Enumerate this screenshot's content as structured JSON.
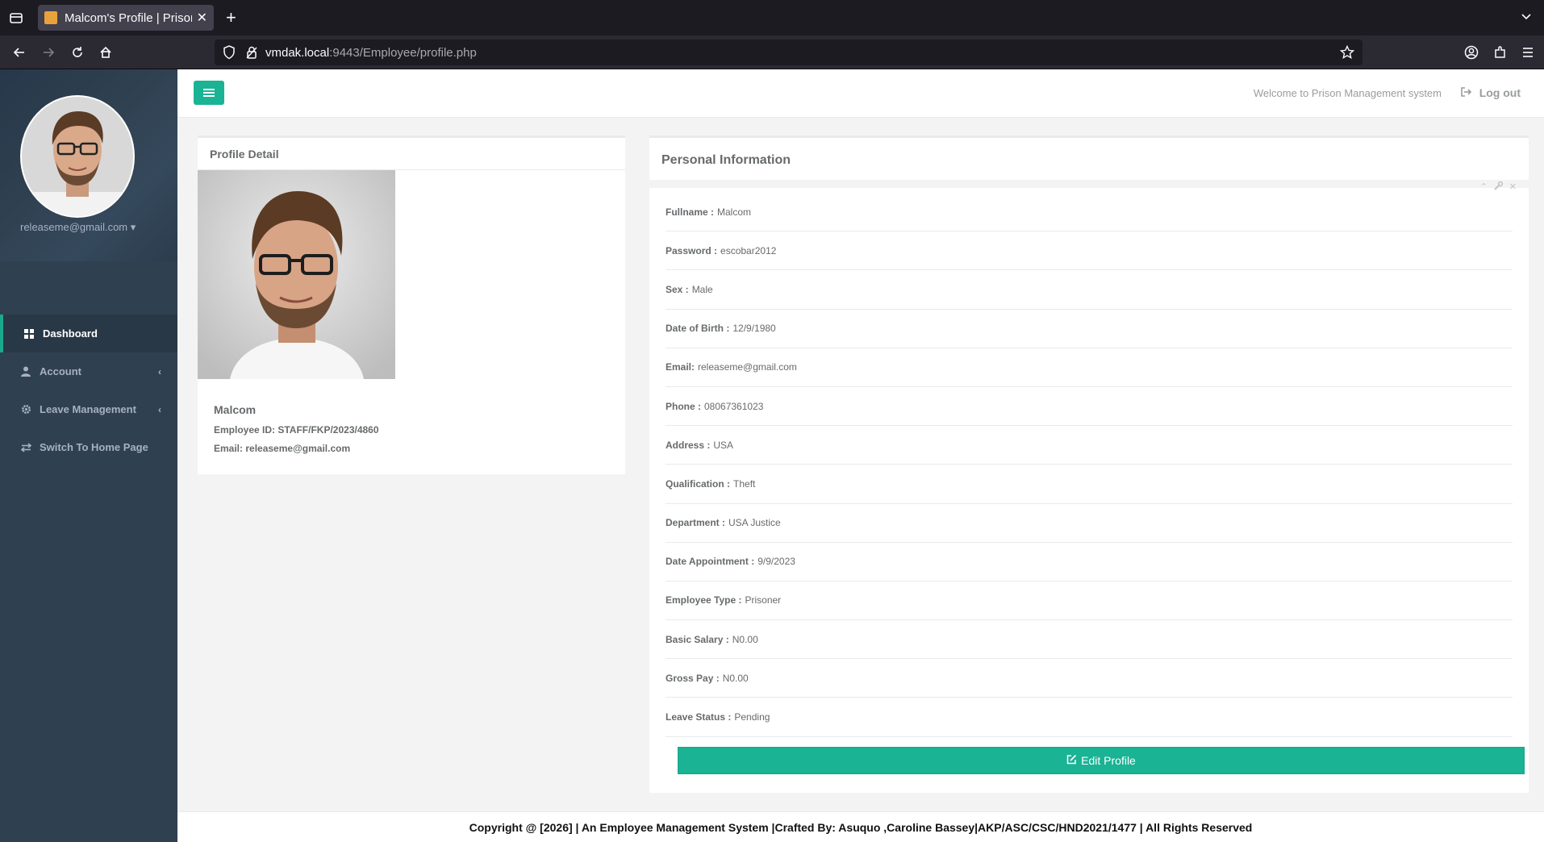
{
  "browser": {
    "tab_title": "Malcom's Profile | Prison Management system",
    "url_host": "vmdak.local",
    "url_path": ":9443/Employee/profile.php",
    "new_tab": "+"
  },
  "sidebar": {
    "user_email": "releaseme@gmail.com",
    "items": [
      {
        "label": "Dashboard",
        "icon": "th-large-icon",
        "active": true
      },
      {
        "label": "Account",
        "icon": "user-icon",
        "arrow": "‹"
      },
      {
        "label": "Leave Management",
        "icon": "cog-icon",
        "arrow": "‹"
      },
      {
        "label": "Switch To Home Page",
        "icon": "exchange-icon"
      }
    ]
  },
  "topbar": {
    "welcome": "Welcome to Prison Management system",
    "logout": "Log out"
  },
  "profile_detail": {
    "title": "Profile Detail",
    "name": "Malcom",
    "employee_id": "Employee ID: STAFF/FKP/2023/4860",
    "email": "Email: releaseme@gmail.com"
  },
  "personal_info": {
    "title": "Personal Information",
    "fields": [
      {
        "label": "Fullname :",
        "value": "Malcom"
      },
      {
        "label": "Password :",
        "value": "escobar2012"
      },
      {
        "label": "Sex :",
        "value": "Male"
      },
      {
        "label": "Date of Birth :",
        "value": "12/9/1980"
      },
      {
        "label": "Email:",
        "value": "releaseme@gmail.com"
      },
      {
        "label": "Phone :",
        "value": "08067361023"
      },
      {
        "label": "Address :",
        "value": "USA"
      },
      {
        "label": "Qualification :",
        "value": "Theft"
      },
      {
        "label": "Department :",
        "value": "USA Justice"
      },
      {
        "label": "Date Appointment :",
        "value": "9/9/2023"
      },
      {
        "label": "Employee Type :",
        "value": "Prisoner"
      },
      {
        "label": "Basic Salary :",
        "value": "N0.00"
      },
      {
        "label": "Gross Pay :",
        "value": "N0.00"
      },
      {
        "label": "Leave Status :",
        "value": "Pending"
      }
    ],
    "edit_button": "Edit Profile"
  },
  "footer": {
    "text": "Copyright @ [2026] | An Employee Management System |Crafted By: Asuquo ,Caroline Bassey|AKP/ASC/CSC/HND2021/1477 | All Rights Reserved"
  },
  "colors": {
    "accent": "#1ab394",
    "sidebar": "#2f4050"
  }
}
